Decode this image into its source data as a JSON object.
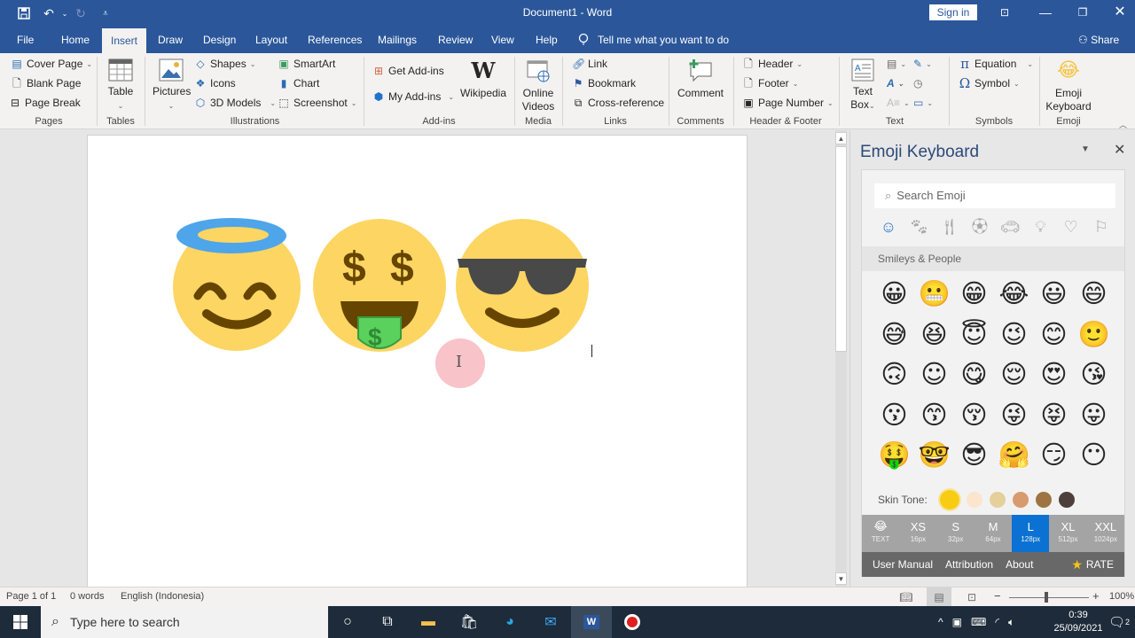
{
  "window": {
    "doc_title": "Document1  -  Word",
    "sign_in": "Sign in",
    "qat": [
      "save-icon",
      "undo-icon",
      "redo-icon",
      "customize-qat-icon"
    ],
    "controls": [
      "ribbon-display-icon",
      "minimize-icon",
      "restore-icon",
      "close-icon"
    ]
  },
  "tabs": [
    {
      "label": "File"
    },
    {
      "label": "Home"
    },
    {
      "label": "Insert",
      "active": true
    },
    {
      "label": "Draw"
    },
    {
      "label": "Design"
    },
    {
      "label": "Layout"
    },
    {
      "label": "References"
    },
    {
      "label": "Mailings"
    },
    {
      "label": "Review"
    },
    {
      "label": "View"
    },
    {
      "label": "Help"
    }
  ],
  "tell_me": "Tell me what you want to do",
  "share": "Share",
  "ribbon": {
    "pages": {
      "label": "Pages",
      "cover_page": "Cover Page",
      "blank_page": "Blank Page",
      "page_break": "Page Break"
    },
    "tables": {
      "label": "Tables",
      "table": "Table"
    },
    "illustrations": {
      "label": "Illustrations",
      "pictures": "Pictures",
      "shapes": "Shapes",
      "icons": "Icons",
      "models": "3D Models",
      "smartart": "SmartArt",
      "chart": "Chart",
      "screenshot": "Screenshot"
    },
    "addins": {
      "label": "Add-ins",
      "get": "Get Add-ins",
      "my": "My Add-ins",
      "wikipedia": "Wikipedia"
    },
    "media": {
      "label": "Media",
      "online_videos_1": "Online",
      "online_videos_2": "Videos"
    },
    "links": {
      "label": "Links",
      "link": "Link",
      "bookmark": "Bookmark",
      "cross_reference": "Cross-reference"
    },
    "comments": {
      "label": "Comments",
      "comment": "Comment"
    },
    "header_footer": {
      "label": "Header & Footer",
      "header": "Header",
      "footer": "Footer",
      "page_number": "Page Number"
    },
    "text": {
      "label": "Text",
      "text_box_1": "Text",
      "text_box_2": "Box"
    },
    "symbols": {
      "label": "Symbols",
      "equation": "Equation",
      "symbol": "Symbol"
    },
    "emoji": {
      "label": "Emoji",
      "keyboard_1": "Emoji",
      "keyboard_2": "Keyboard"
    }
  },
  "document": {
    "emojis": [
      "smiling-face-with-halo",
      "money-mouth-face",
      "smiling-face-with-sunglasses"
    ]
  },
  "emoji_pane": {
    "title": "Emoji Keyboard",
    "search_placeholder": "Search Emoji",
    "categories": [
      "smileys-icon",
      "animals-icon",
      "food-icon",
      "activity-icon",
      "travel-icon",
      "objects-icon",
      "symbols-icon",
      "flags-icon"
    ],
    "section": "Smileys & People",
    "emojis": [
      "😀",
      "😬",
      "😁",
      "😂",
      "😃",
      "😄",
      "😅",
      "😆",
      "😇",
      "😉",
      "😊",
      "🙂",
      "🙃",
      "☺",
      "😋",
      "😌",
      "😍",
      "😘",
      "😗",
      "😙",
      "😚",
      "😜",
      "😝",
      "😛",
      "🤑",
      "🤓",
      "😎",
      "🤗",
      "😏",
      "😶"
    ],
    "skin_tone_label": "Skin Tone:",
    "skin_tones": [
      "#f9cc14",
      "#fbe5cd",
      "#e5cf9b",
      "#d79b6d",
      "#9e7443",
      "#4f3f3b"
    ],
    "sizes": [
      {
        "name": "TEXT",
        "px": "",
        "emoji": "😂"
      },
      {
        "name": "XS",
        "px": "16px"
      },
      {
        "name": "S",
        "px": "32px"
      },
      {
        "name": "M",
        "px": "64px"
      },
      {
        "name": "L",
        "px": "128px",
        "selected": true
      },
      {
        "name": "XL",
        "px": "512px"
      },
      {
        "name": "XXL",
        "px": "1024px"
      }
    ],
    "links": [
      "User Manual",
      "Attribution",
      "About"
    ],
    "rate": "RATE"
  },
  "status": {
    "page": "Page 1 of 1",
    "words": "0 words",
    "language": "English (Indonesia)",
    "zoom": "100%",
    "zoom_minus": "−",
    "zoom_plus": "+"
  },
  "taskbar": {
    "search_placeholder": "Type here to search",
    "time": "0:39",
    "date": "25/09/2021",
    "notifications": "2"
  }
}
